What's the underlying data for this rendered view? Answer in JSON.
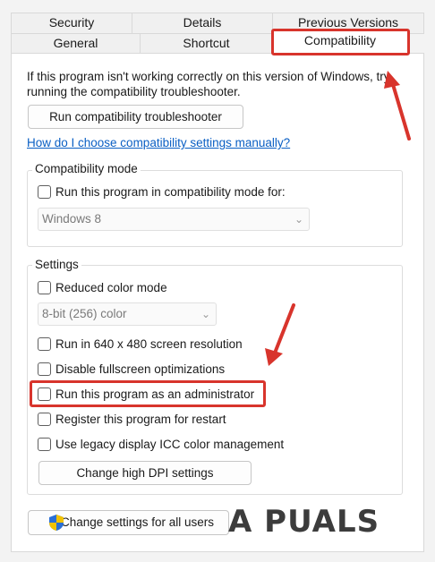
{
  "tabs": {
    "back": [
      "Security",
      "Details",
      "Previous Versions"
    ],
    "front": [
      "General",
      "Shortcut",
      "Compatibility"
    ]
  },
  "intro": {
    "line1": "If this program isn't working correctly on this version of Windows, try",
    "line2": "running the compatibility troubleshooter."
  },
  "troubleshoot_button": "Run compatibility troubleshooter",
  "help_link": "How do I choose compatibility settings manually?",
  "compat_mode": {
    "title": "Compatibility mode",
    "checkbox": "Run this program in compatibility mode for:",
    "select_value": "Windows 8"
  },
  "settings": {
    "title": "Settings",
    "reduced_color": "Reduced color mode",
    "color_select": "8-bit (256) color",
    "res_640": "Run in 640 x 480 screen resolution",
    "disable_fullscreen": "Disable fullscreen optimizations",
    "run_admin": "Run this program as an administrator",
    "register_restart": "Register this program for restart",
    "legacy_icc": "Use legacy display ICC color management",
    "dpi_button": "Change high DPI settings"
  },
  "all_users_button": "Change settings for all users",
  "watermark": "A PUALS",
  "colors": {
    "highlight": "#d8342c",
    "link": "#0a5fc4",
    "shield_blue": "#2a6fd6",
    "shield_yellow": "#f2c200"
  }
}
